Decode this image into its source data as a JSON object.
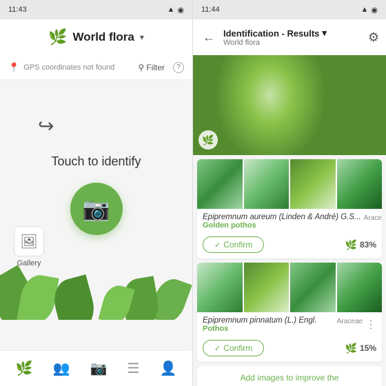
{
  "left": {
    "statusBar": {
      "time": "11:43",
      "icons": "▲ ◉"
    },
    "header": {
      "logo": "🌿",
      "title": "World flora",
      "chevron": "▾"
    },
    "filterBar": {
      "gpsText": "GPS coordinates not found",
      "filterLabel": "Filter",
      "helpTitle": "?"
    },
    "identify": {
      "touchLabel": "Touch to identify"
    },
    "gallery": {
      "label": "Gallery"
    },
    "bottomNav": [
      {
        "icon": "🌿",
        "label": "Flora",
        "active": false
      },
      {
        "icon": "👥",
        "label": "Community",
        "active": false
      },
      {
        "icon": "📷",
        "label": "Camera",
        "active": true
      },
      {
        "icon": "☰",
        "label": "List",
        "active": false
      },
      {
        "icon": "👤",
        "label": "Profile",
        "active": false
      }
    ]
  },
  "right": {
    "statusBar": {
      "time": "11:44",
      "icons": "▲ ◉"
    },
    "header": {
      "backIcon": "←",
      "title": "Identification - Results",
      "chevron": "▾",
      "subtitle": "World flora",
      "filterIcon": "⚲"
    },
    "results": [
      {
        "speciesName": "Epipremnum aureum (Linden & André) G.S...",
        "commonName": "Golden pothos",
        "family": "Araceae",
        "confirmLabel": "Confirm",
        "confidence": "83%"
      },
      {
        "speciesName": "Epipremnum pinnatum (L.) Engl.",
        "commonName": "Pothos",
        "family": "Araceae",
        "confirmLabel": "Confirm",
        "confidence": "15%"
      }
    ],
    "addImagesLabel": "Add images to improve the"
  }
}
